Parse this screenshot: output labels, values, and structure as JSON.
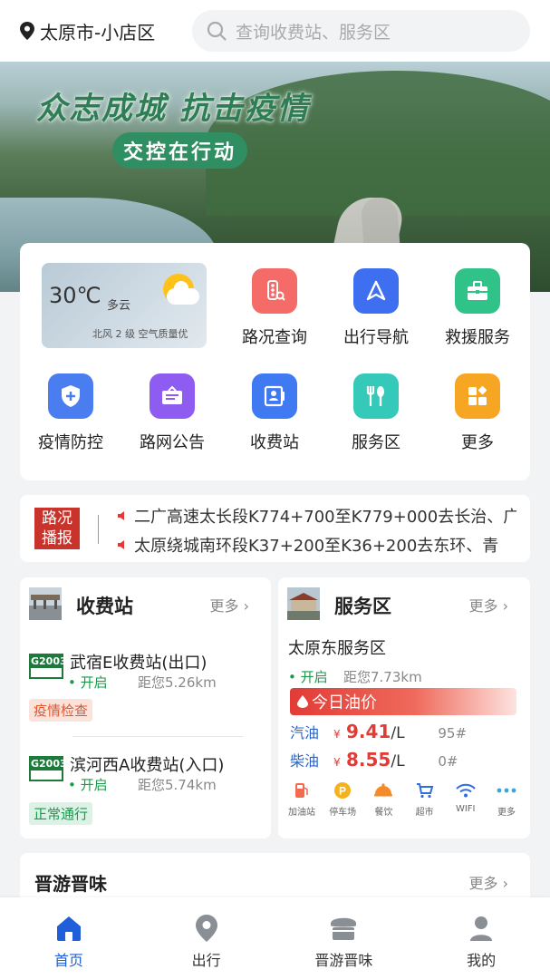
{
  "header": {
    "location": "太原市-小店区",
    "search_placeholder": "查询收费站、服务区"
  },
  "banner": {
    "slogan_main": "众志成城 抗击疫情",
    "slogan_sub": "交控在行动"
  },
  "weather": {
    "temp": "30℃",
    "desc": "多云",
    "detail": "北风 2 级 空气质量优"
  },
  "quick_menu": [
    {
      "label": "路况查询",
      "icon": "traffic-light-icon",
      "color": "#f46b68"
    },
    {
      "label": "出行导航",
      "icon": "navigation-icon",
      "color": "#3d6ff0"
    },
    {
      "label": "救援服务",
      "icon": "toolbox-icon",
      "color": "#2fc38a"
    },
    {
      "label": "疫情防控",
      "icon": "shield-plus-icon",
      "color": "#4a7df0"
    },
    {
      "label": "路网公告",
      "icon": "notice-board-icon",
      "color": "#8e5cf0"
    },
    {
      "label": "收费站",
      "icon": "toll-card-icon",
      "color": "#3f7af3"
    },
    {
      "label": "服务区",
      "icon": "fork-spoon-icon",
      "color": "#35c9b9"
    },
    {
      "label": "更多",
      "icon": "grid-icon",
      "color": "#f6a623"
    }
  ],
  "news": {
    "badge_line1": "路况",
    "badge_line2": "播报",
    "items": [
      "二广高速太长段K774+700至K779+000去长治、广",
      "太原绕城南环段K37+200至K36+200去东环、青"
    ]
  },
  "toll_card": {
    "title": "收费站",
    "more": "更多",
    "badge": "G2003",
    "stations": [
      {
        "name": "武宿E收费站(出口)",
        "status": "• 开启",
        "distance": "距您5.26km",
        "tag": "疫情检查"
      },
      {
        "name": "滨河西A收费站(入口)",
        "status": "• 开启",
        "distance": "距您5.74km",
        "tag": "正常通行"
      }
    ]
  },
  "service_card": {
    "title": "服务区",
    "more": "更多",
    "name": "太原东服务区",
    "status": "• 开启",
    "distance": "距您7.73km",
    "oil_title": "今日油价",
    "oils": [
      {
        "type": "汽油",
        "yen": "¥",
        "price": "9.41",
        "unit": "/L",
        "grade": "95#"
      },
      {
        "type": "柴油",
        "yen": "¥",
        "price": "8.55",
        "unit": "/L",
        "grade": "0#"
      }
    ],
    "facilities": [
      {
        "label": "加油站",
        "icon": "fuel-pump-icon"
      },
      {
        "label": "停车场",
        "icon": "parking-icon"
      },
      {
        "label": "餐饮",
        "icon": "dining-icon"
      },
      {
        "label": "超市",
        "icon": "cart-icon"
      },
      {
        "label": "WIFI",
        "icon": "wifi-icon"
      },
      {
        "label": "更多",
        "icon": "more-dots-icon"
      }
    ]
  },
  "jinyou": {
    "title": "晋游晋味",
    "more": "更多"
  },
  "tabbar": [
    {
      "label": "首页",
      "icon": "home-icon",
      "active": true
    },
    {
      "label": "出行",
      "icon": "location-pin-icon",
      "active": false
    },
    {
      "label": "晋游晋味",
      "icon": "shop-icon",
      "active": false
    },
    {
      "label": "我的",
      "icon": "person-icon",
      "active": false
    }
  ],
  "colors": {
    "accent": "#1f5fd9",
    "open_green": "#1a9a4a",
    "price_red": "#e23b36"
  }
}
